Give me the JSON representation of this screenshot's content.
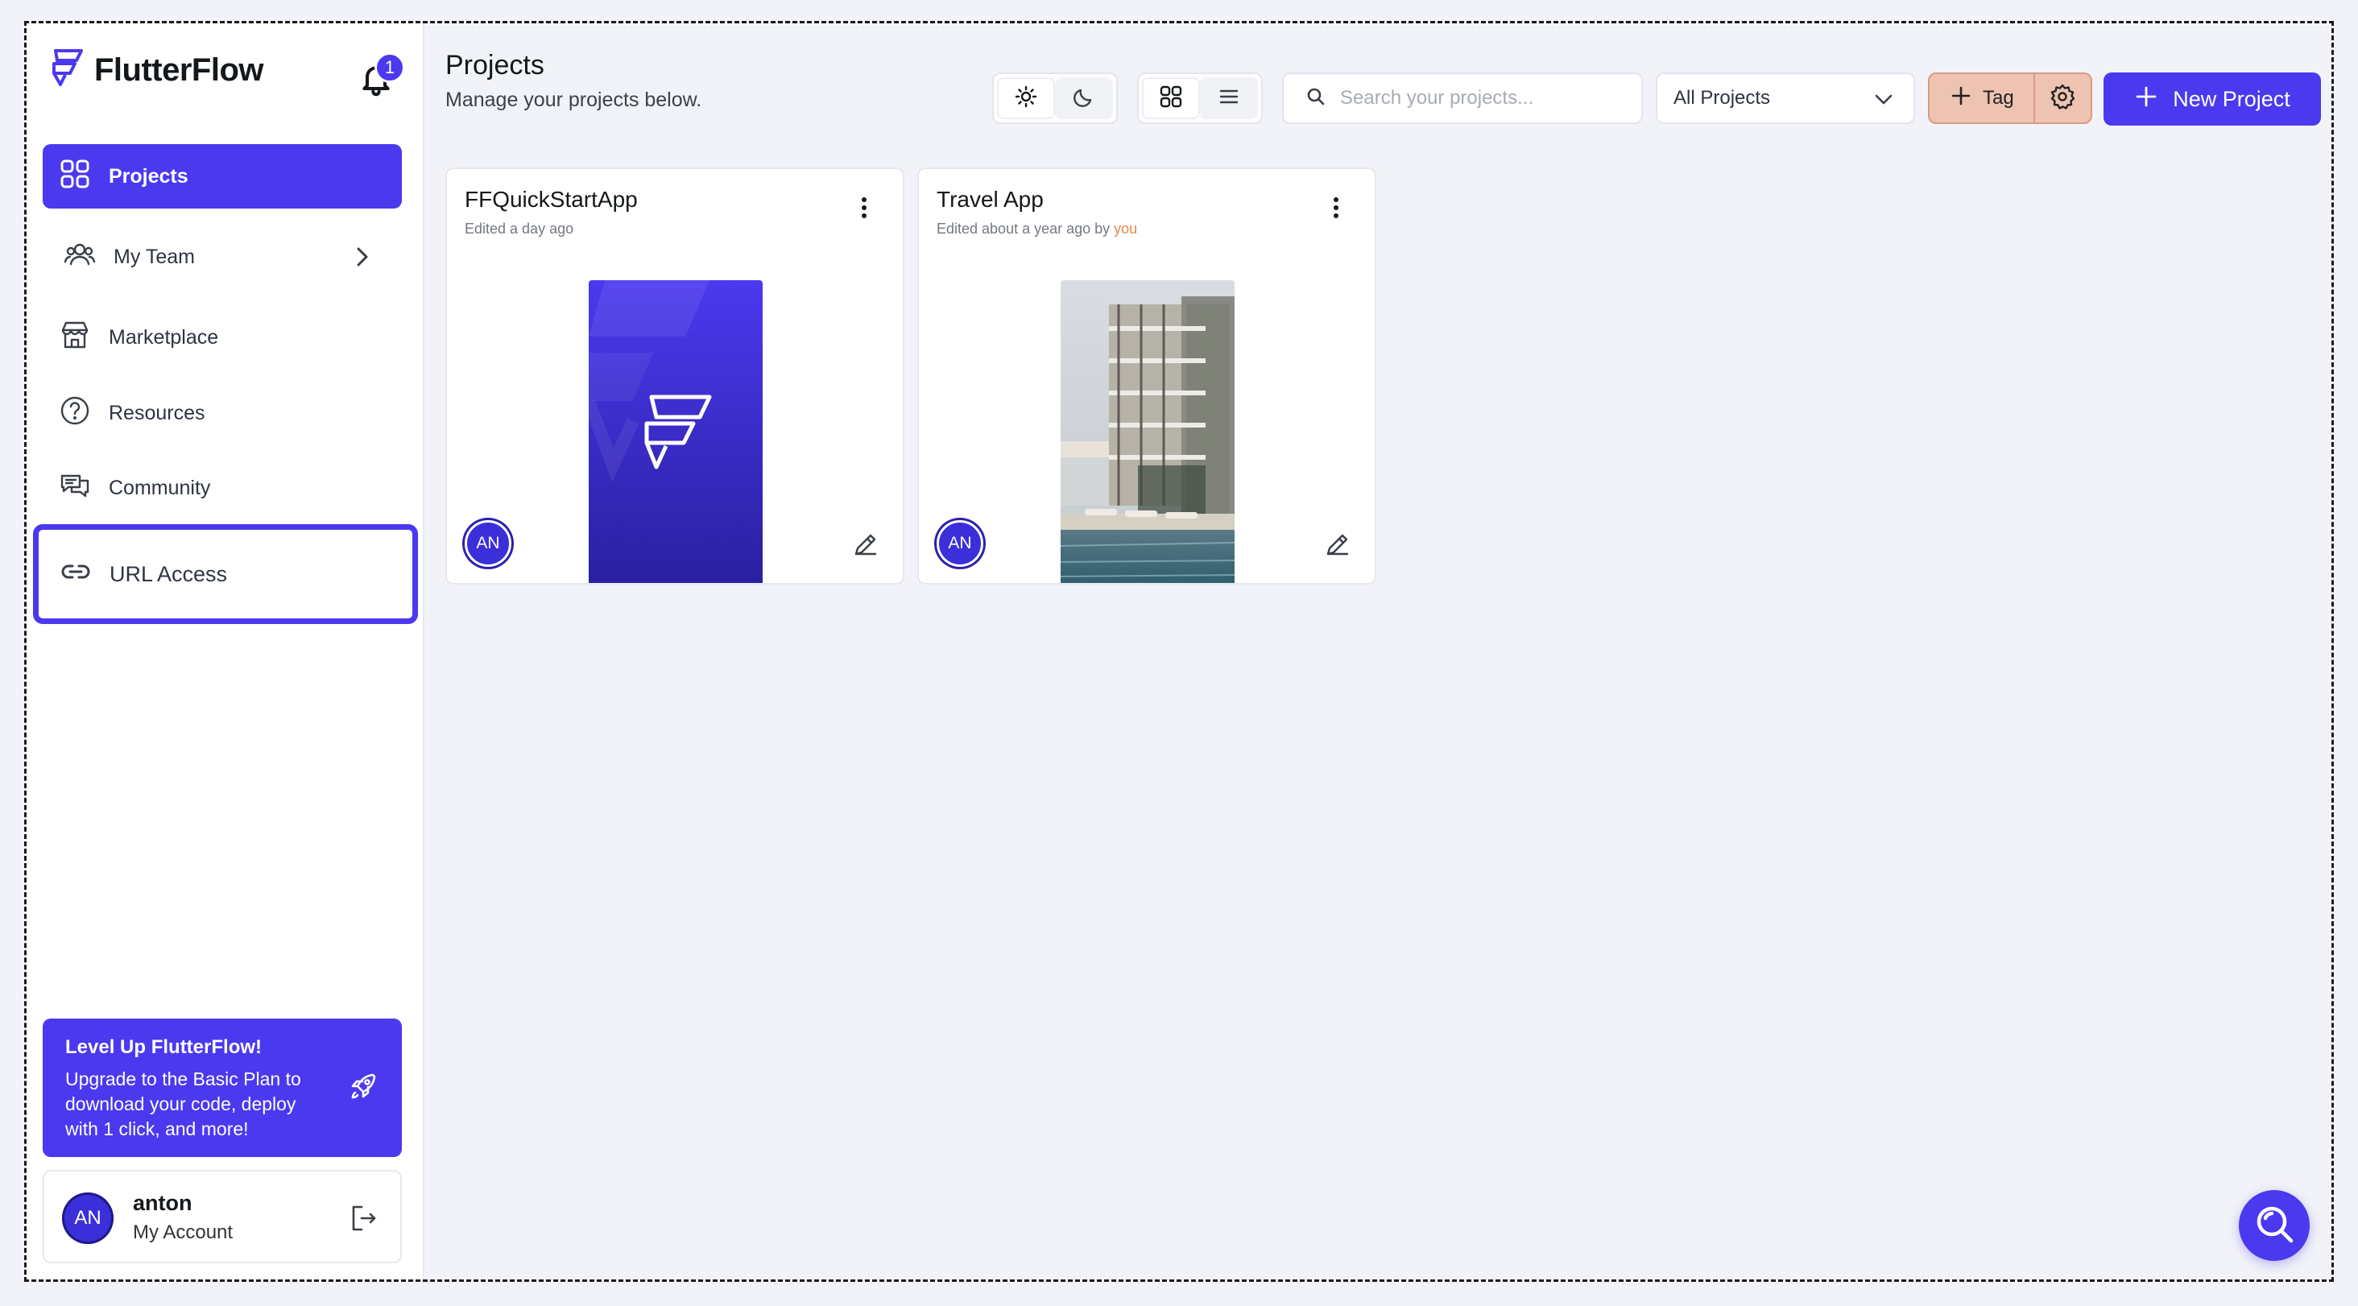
{
  "brand": {
    "name": "FlutterFlow"
  },
  "notifications": {
    "count": "1"
  },
  "sidebar": {
    "items": [
      {
        "label": "Projects"
      },
      {
        "label": "My Team"
      },
      {
        "label": "Marketplace"
      },
      {
        "label": "Resources"
      },
      {
        "label": "Community"
      },
      {
        "label": "URL Access"
      }
    ]
  },
  "promo": {
    "title": "Level Up FlutterFlow!",
    "body": "Upgrade to the Basic Plan to download your code, deploy with 1 click, and more!"
  },
  "account": {
    "initials": "AN",
    "name": "anton",
    "sub": "My Account"
  },
  "header": {
    "title": "Projects",
    "subtitle": "Manage your projects below."
  },
  "search": {
    "placeholder": "Search your projects...",
    "value": ""
  },
  "filter": {
    "selected": "All Projects"
  },
  "tag": {
    "label": "Tag"
  },
  "new_project": {
    "label": "New Project"
  },
  "projects": [
    {
      "title": "FFQuickStartApp",
      "edited": "Edited a day ago",
      "by": "",
      "owner_initials": "AN"
    },
    {
      "title": "Travel App",
      "edited": "Edited about a year ago by",
      "by": "you",
      "owner_initials": "AN"
    }
  ],
  "colors": {
    "accent": "#4b39ef",
    "tag_bg": "#eec3b2",
    "you_link": "#e3874a"
  },
  "icons": [
    "flutterflow-logo-icon",
    "bell-icon",
    "grid-icon",
    "team-icon",
    "chevron-right-icon",
    "store-icon",
    "help-circle-icon",
    "chat-icon",
    "link-icon",
    "rocket-icon",
    "logout-icon",
    "sun-icon",
    "moon-icon",
    "list-icon",
    "search-icon",
    "chevron-down-icon",
    "plus-icon",
    "gear-icon",
    "more-vertical-icon",
    "edit-icon"
  ]
}
